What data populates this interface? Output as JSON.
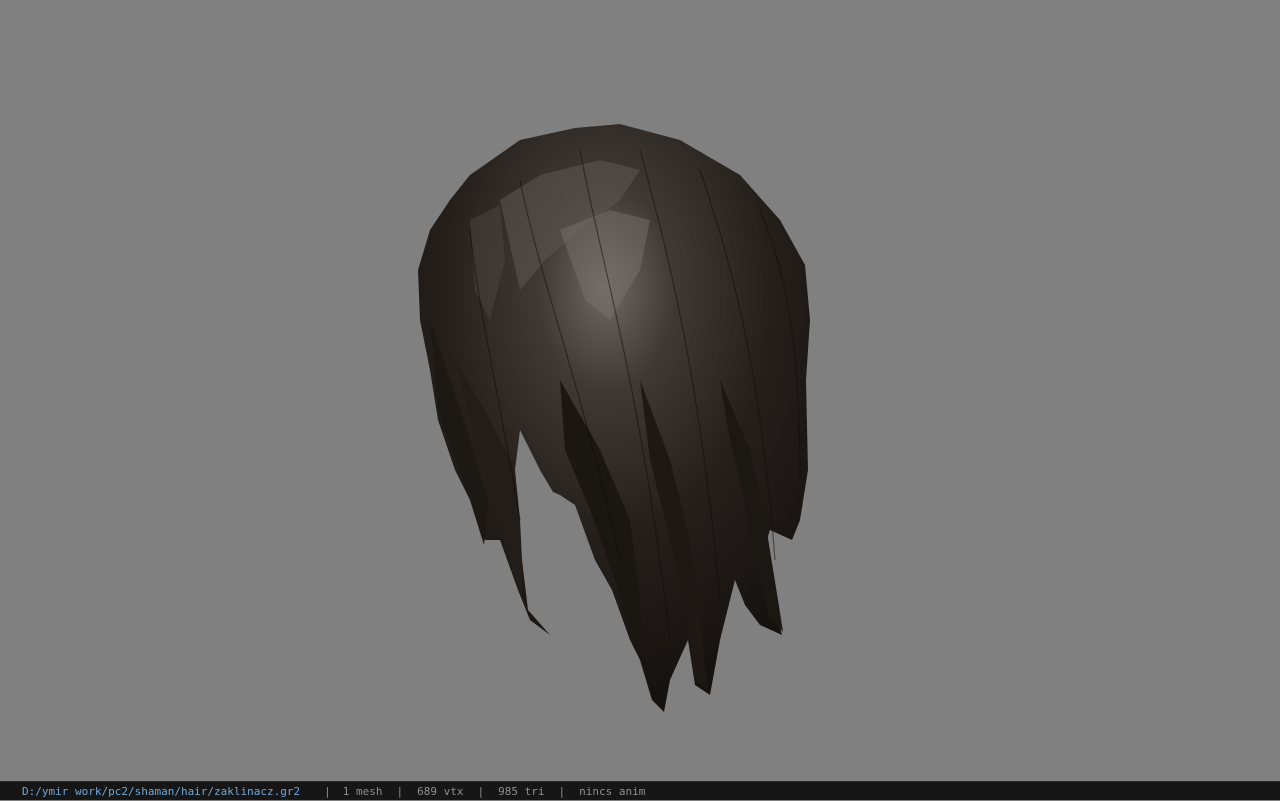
{
  "viewer": {
    "background_color": "#808080",
    "model_preview": "hair-mesh"
  },
  "status": {
    "file_path": "D:/ymir work/pc2/shaman/hair/zaklinacz.gr2",
    "separator": "|",
    "mesh_count": "1 mesh",
    "vertex_count": "689 vtx",
    "triangle_count": "985 tri",
    "animation": "nincs anim"
  }
}
